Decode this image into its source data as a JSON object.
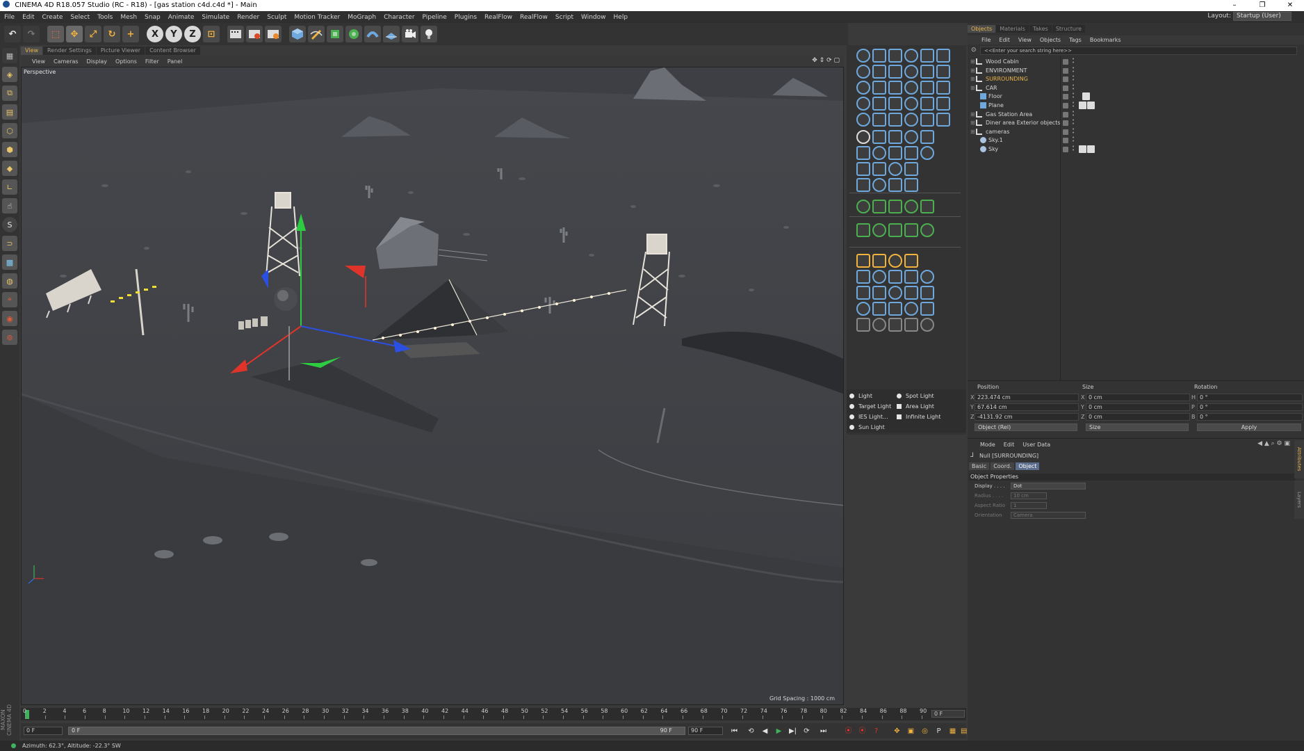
{
  "window": {
    "title": "CINEMA 4D R18.057 Studio (RC - R18) - [gas station c4d.c4d *] - Main",
    "buttons": [
      "–",
      "❐",
      "✕"
    ]
  },
  "menu": {
    "items": [
      "File",
      "Edit",
      "Create",
      "Select",
      "Tools",
      "Mesh",
      "Snap",
      "Animate",
      "Simulate",
      "Render",
      "Sculpt",
      "Motion Tracker",
      "MoGraph",
      "Character",
      "Pipeline",
      "Plugins",
      "RealFlow",
      "RealFlow",
      "Script",
      "Window",
      "Help"
    ]
  },
  "layout": {
    "label": "Layout:",
    "value": "Startup (User)"
  },
  "toolbar": {
    "undo": "↶",
    "redo": "↷",
    "select": "⬚",
    "move": "✥",
    "scale": "⤢",
    "rotate": "↻",
    "add": "+",
    "x": "X",
    "y": "Y",
    "z": "Z",
    "coord": "⊡"
  },
  "viewport": {
    "tabs": [
      "View",
      "Render Settings",
      "Picture Viewer",
      "Content Browser"
    ],
    "menu": [
      "View",
      "Cameras",
      "Display",
      "Options",
      "Filter",
      "Panel"
    ],
    "nav": "✥ ⇕ ⟳ ▢",
    "label": "Perspective",
    "grid_spacing": "Grid Spacing : 1000 cm"
  },
  "lights": [
    "Light",
    "Spot Light",
    "Target Light",
    "Area Light",
    "IES Light...",
    "Infinite Light",
    "Sun Light"
  ],
  "panel": {
    "tabs": [
      "Objects",
      "Materials",
      "Takes",
      "Structure"
    ],
    "menu": [
      "File",
      "Edit",
      "View",
      "Objects",
      "Tags",
      "Bookmarks"
    ],
    "search_placeholder": "<<Enter your search string here>>",
    "objects": [
      {
        "name": "Wood Cabin",
        "color": "#d5d5d5"
      },
      {
        "name": "ENVIRONMENT",
        "color": "#d5d5d5"
      },
      {
        "name": "SURROUNDING",
        "color": "#e8b34a"
      },
      {
        "name": "CAR",
        "color": "#d5d5d5"
      },
      {
        "name": "Floor",
        "color": "#d5d5d5"
      },
      {
        "name": "Plane",
        "color": "#d5d5d5"
      },
      {
        "name": "Gas Station Area",
        "color": "#d5d5d5"
      },
      {
        "name": "Diner area Exterior objects",
        "color": "#d5d5d5"
      },
      {
        "name": "cameras",
        "color": "#d5d5d5"
      },
      {
        "name": "Sky.1",
        "color": "#d5d5d5"
      },
      {
        "name": "Sky",
        "color": "#d5d5d5"
      }
    ]
  },
  "coords": {
    "headers": {
      "position": "Position",
      "size": "Size",
      "rotation": "Rotation"
    },
    "x": {
      "label": "X",
      "pos": "223.474 cm",
      "slabel": "X",
      "size": "0 cm",
      "rlabel": "H",
      "rot": "0 °"
    },
    "y": {
      "label": "Y",
      "pos": "67.614 cm",
      "slabel": "Y",
      "size": "0 cm",
      "rlabel": "P",
      "rot": "0 °"
    },
    "z": {
      "label": "Z",
      "pos": "-4131.92 cm",
      "slabel": "Z",
      "size": "0 cm",
      "rlabel": "B",
      "rot": "0 °"
    },
    "mode": "Object (Rel)",
    "size_mode": "Size",
    "apply": "Apply"
  },
  "attributes": {
    "menu": [
      "Mode",
      "Edit",
      "User Data"
    ],
    "title": "Null [SURROUNDING]",
    "tabs": [
      "Basic",
      "Coord.",
      "Object"
    ],
    "section": "Object Properties",
    "rows": [
      {
        "label": "Display . . . .",
        "value": "Dot"
      },
      {
        "label": "Radius . . . .",
        "value": "10 cm"
      },
      {
        "label": "Aspect Ratio",
        "value": "1"
      },
      {
        "label": "Orientation",
        "value": "Camera"
      }
    ],
    "side_tabs": [
      "Attributes",
      "Layers"
    ]
  },
  "timeline": {
    "ticks": [
      "0",
      "2",
      "4",
      "6",
      "8",
      "10",
      "12",
      "14",
      "16",
      "18",
      "20",
      "22",
      "24",
      "26",
      "28",
      "30",
      "32",
      "34",
      "36",
      "38",
      "40",
      "42",
      "44",
      "46",
      "48",
      "50",
      "52",
      "54",
      "56",
      "58",
      "60",
      "62",
      "64",
      "66",
      "68",
      "70",
      "72",
      "74",
      "76",
      "78",
      "80",
      "82",
      "84",
      "86",
      "88",
      "90"
    ],
    "end_frame": "0 F",
    "start_field": "0 F",
    "slider_start": "0 F",
    "slider_end": "90 F",
    "end_field": "90 F"
  },
  "status": "Azimuth: 62.3°, Altitude: -22.3° SW",
  "maxon": "MAXON CINEMA 4D"
}
